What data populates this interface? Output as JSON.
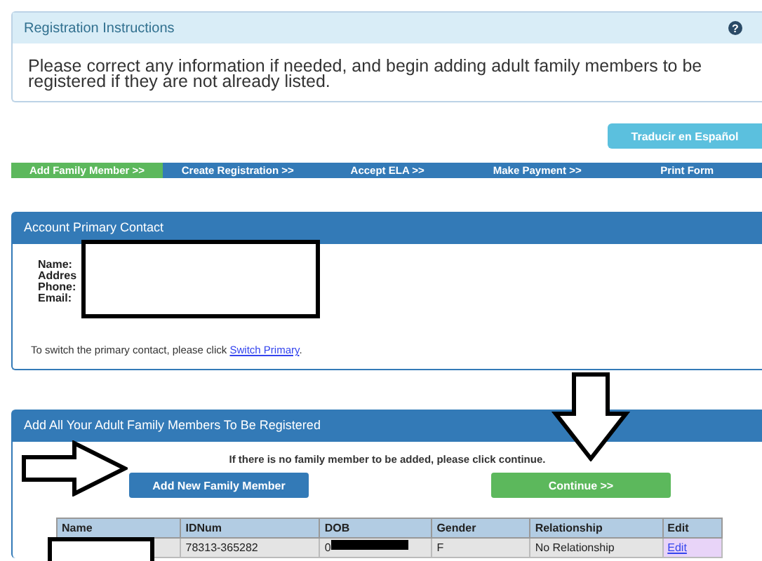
{
  "instructions": {
    "title": "Registration Instructions",
    "help": "?",
    "text": "Please correct any information if needed, and begin adding adult family members to be registered if they are not already listed."
  },
  "translate_button": "Traducir en Español",
  "steps": [
    {
      "label": "Add Family Member >>",
      "selected": true
    },
    {
      "label": "Create Registration >>",
      "selected": false
    },
    {
      "label": "Accept ELA >>",
      "selected": false
    },
    {
      "label": "Make Payment >>",
      "selected": false
    },
    {
      "label": "Print Form",
      "selected": false
    }
  ],
  "primary_contact": {
    "title": "Account Primary Contact",
    "fields": [
      "Name:",
      "Addres",
      "Phone:",
      "Email:"
    ],
    "switch_text": "To switch the primary contact, please click ",
    "switch_link": "Switch Primary",
    "switch_end": "."
  },
  "family": {
    "title": "Add All Your Adult Family Members To Be Registered",
    "note": "If there is no family member to be added, please click continue.",
    "add_button": "Add New Family Member",
    "continue_button": "Continue >>",
    "table": {
      "columns": [
        "Name",
        "IDNum",
        "DOB",
        "Gender",
        "Relationship",
        "Edit"
      ],
      "rows": [
        {
          "idnum": "78313-365282",
          "dob": "0",
          "gender": "F",
          "relationship": "No Relationship",
          "edit": "Edit"
        }
      ]
    }
  }
}
